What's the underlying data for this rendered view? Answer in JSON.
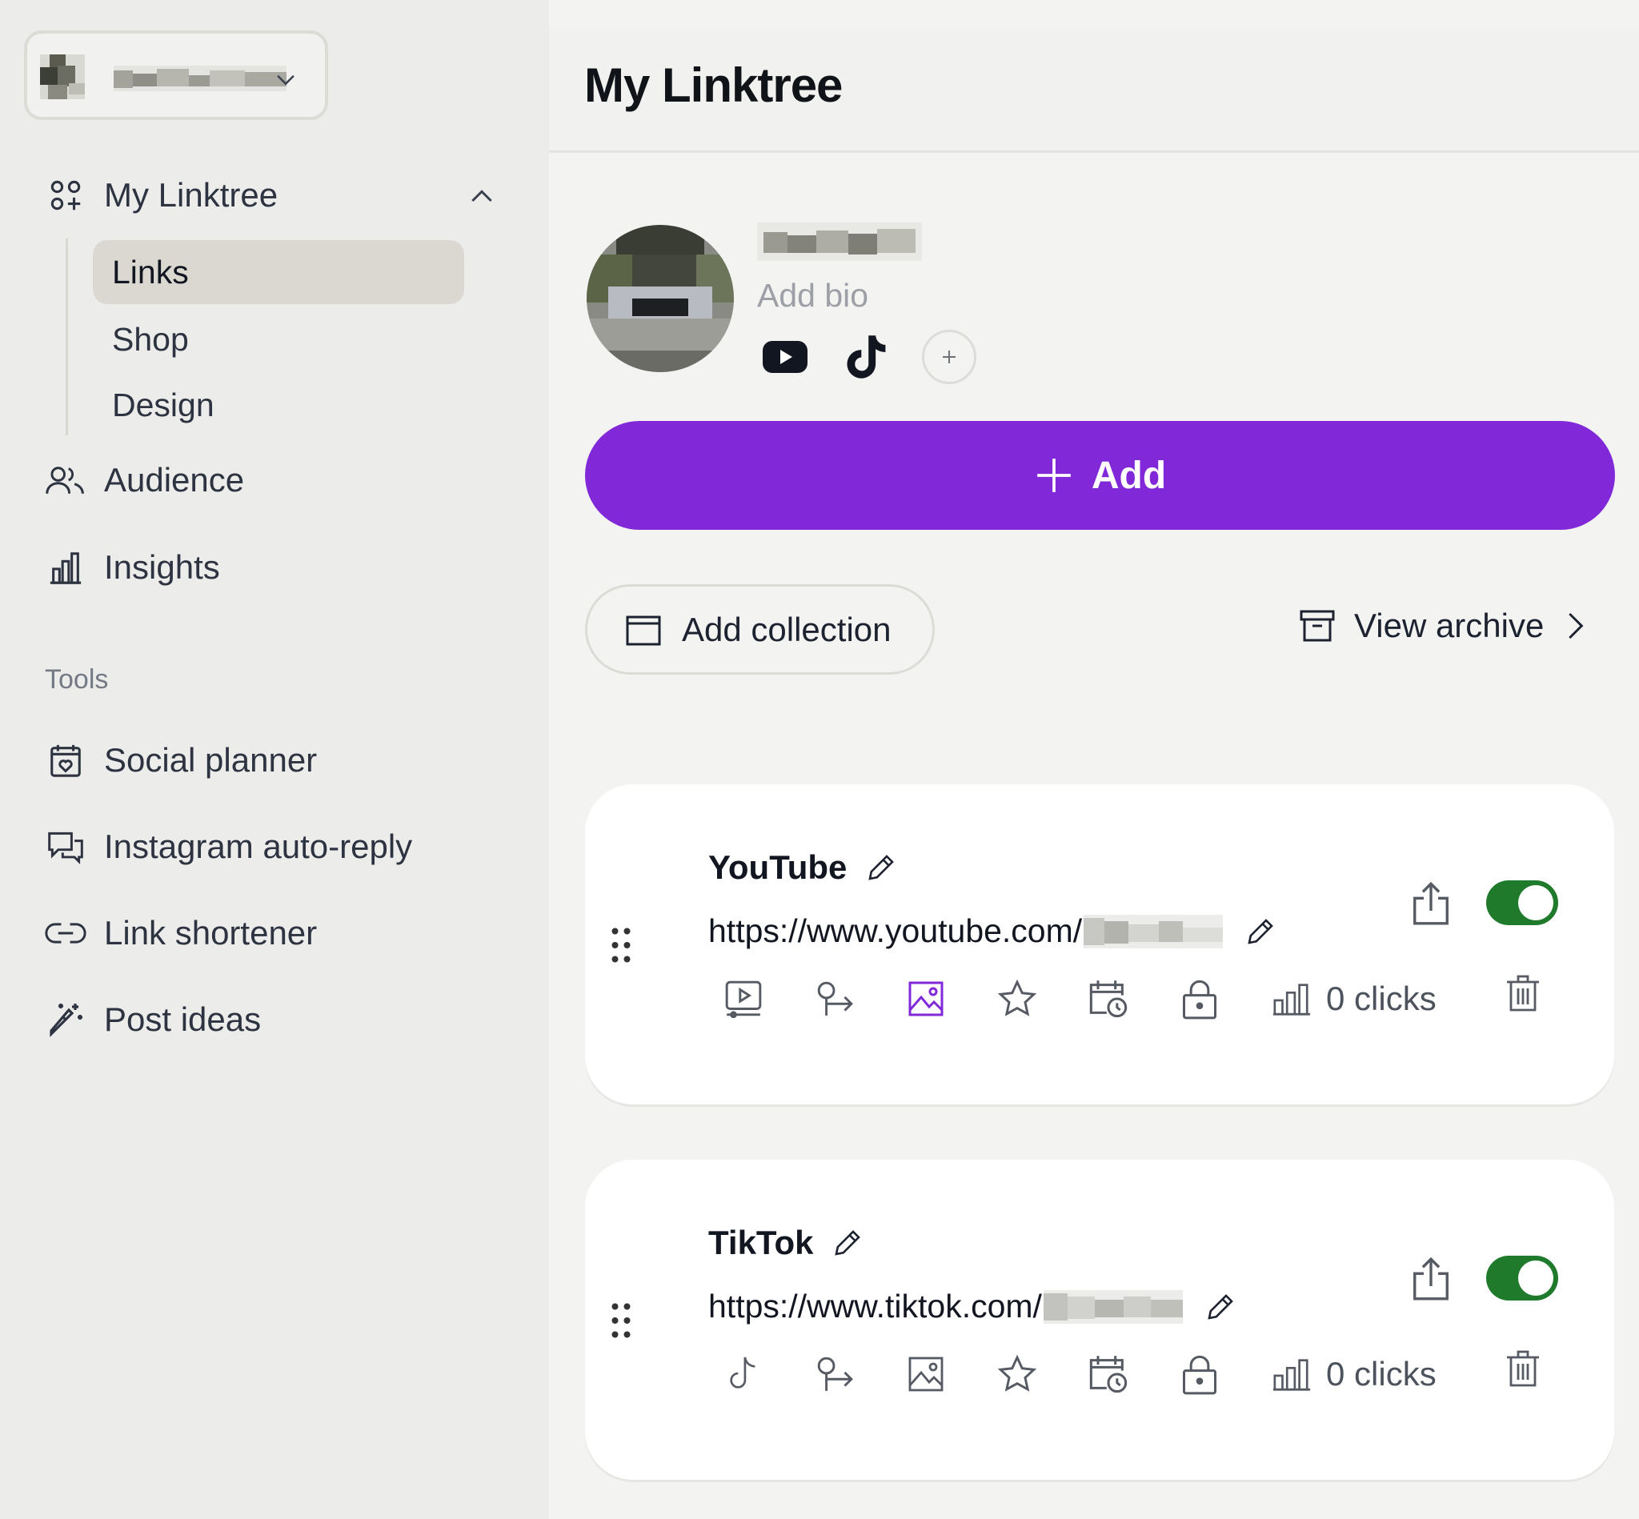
{
  "sidebar": {
    "nav": [
      {
        "label": "My Linktree",
        "icon": "apps-icon"
      },
      {
        "label": "Audience",
        "icon": "people-icon"
      },
      {
        "label": "Insights",
        "icon": "bar-chart-icon"
      }
    ],
    "sub_items": [
      {
        "label": "Links",
        "active": true
      },
      {
        "label": "Shop",
        "active": false
      },
      {
        "label": "Design",
        "active": false
      }
    ],
    "tools_label": "Tools",
    "tools": [
      {
        "label": "Social planner",
        "icon": "calendar-heart-icon"
      },
      {
        "label": "Instagram auto-reply",
        "icon": "chat-bubbles-icon"
      },
      {
        "label": "Link shortener",
        "icon": "link-icon"
      },
      {
        "label": "Post ideas",
        "icon": "magic-wand-icon"
      }
    ]
  },
  "header": {
    "title": "My Linktree"
  },
  "profile": {
    "bio_placeholder": "Add bio",
    "socials": [
      "youtube-icon",
      "tiktok-icon"
    ]
  },
  "actions": {
    "add_label": "Add",
    "add_collection_label": "Add collection",
    "view_archive_label": "View archive"
  },
  "links": [
    {
      "title": "YouTube",
      "url": "https://www.youtube.com/",
      "clicks": "0 clicks",
      "enabled": true,
      "first_tool": "video-icon"
    },
    {
      "title": "TikTok",
      "url": "https://www.tiktok.com/",
      "clicks": "0 clicks",
      "enabled": true,
      "first_tool": "tiktok-icon"
    }
  ],
  "colors": {
    "accent": "#8129d9",
    "toggle_on": "#1f7a2c",
    "sidebar_bg": "#ececea",
    "active_item_bg": "#dad8d1"
  }
}
